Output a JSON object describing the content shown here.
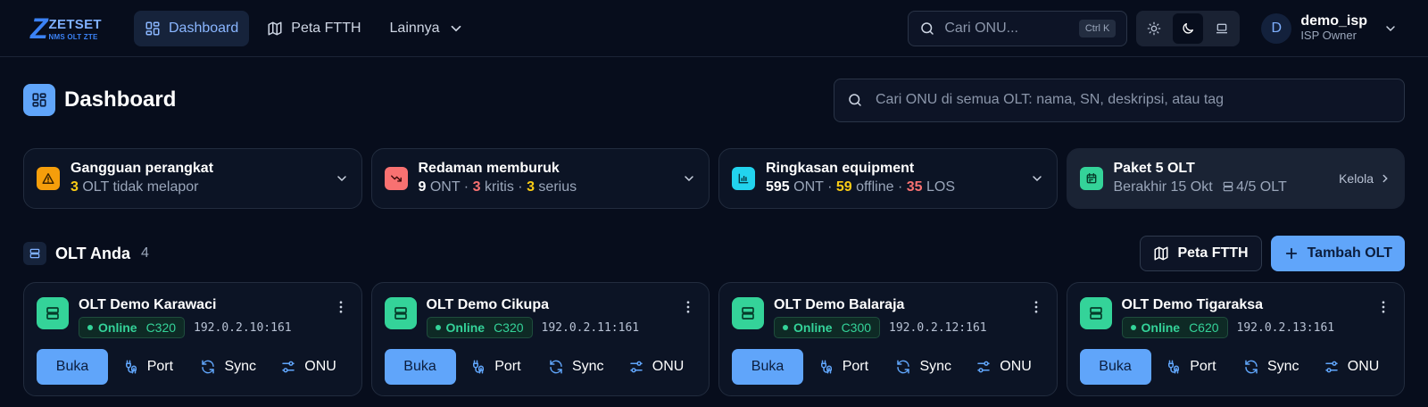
{
  "brand": {
    "mark": "Z",
    "name": "ZETSET",
    "sub": "NMS OLT ZTE"
  },
  "nav": [
    {
      "label": "Dashboard",
      "icon": "dashboard-icon",
      "active": true
    },
    {
      "label": "Peta FTTH",
      "icon": "map-icon",
      "active": false
    },
    {
      "label": "Lainnya",
      "icon": "chevron-down-icon",
      "active": false
    }
  ],
  "topsearch": {
    "placeholder": "Cari ONU...",
    "shortcut": "Ctrl K"
  },
  "theme": {
    "options": [
      "light",
      "dark",
      "system"
    ],
    "selected": "dark"
  },
  "user": {
    "initial": "D",
    "name": "demo_isp",
    "role": "ISP Owner"
  },
  "page": {
    "title": "Dashboard"
  },
  "globalsearch": {
    "placeholder": "Cari ONU di semua OLT: nama, SN, deskripsi, atau tag"
  },
  "alerts": {
    "device": {
      "title": "Gangguan perangkat",
      "count": "3",
      "text": "OLT tidak melapor",
      "badge_color": "#f59e0b"
    },
    "attenuation": {
      "title": "Redaman memburuk",
      "ont": "9",
      "ont_label": "ONT",
      "sep": "·",
      "critical": "3",
      "critical_label": "kritis",
      "serious": "3",
      "serious_label": "serius",
      "badge_color": "#f87171"
    },
    "equipment": {
      "title": "Ringkasan equipment",
      "ont": "595",
      "ont_label": "ONT",
      "sep": "·",
      "offline": "59",
      "offline_label": "offline",
      "los": "35",
      "los_label": "LOS",
      "badge_color": "#22d3ee"
    },
    "plan": {
      "title": "Paket 5 OLT",
      "expires": "Berakhir 15 Okt",
      "usage": "4/5 OLT",
      "manage": "Kelola",
      "badge_color": "#34d399"
    }
  },
  "olt_section": {
    "title": "OLT Anda",
    "count": "4",
    "map_button": "Peta FTTH",
    "add_button": "Tambah OLT"
  },
  "olts": [
    {
      "name": "OLT Demo Karawaci",
      "status": "Online",
      "model": "C320",
      "address": "192.0.2.10:161"
    },
    {
      "name": "OLT Demo Cikupa",
      "status": "Online",
      "model": "C320",
      "address": "192.0.2.11:161"
    },
    {
      "name": "OLT Demo Balaraja",
      "status": "Online",
      "model": "C300",
      "address": "192.0.2.12:161"
    },
    {
      "name": "OLT Demo Tigaraksa",
      "status": "Online",
      "model": "C620",
      "address": "192.0.2.13:161"
    }
  ],
  "olt_actions": {
    "open": "Buka",
    "port": "Port",
    "sync": "Sync",
    "onu": "ONU"
  },
  "colors": {
    "accent": "#60a5fa",
    "success": "#34d399",
    "warning": "#facc15",
    "danger": "#f87171",
    "background": "#070d1c"
  }
}
